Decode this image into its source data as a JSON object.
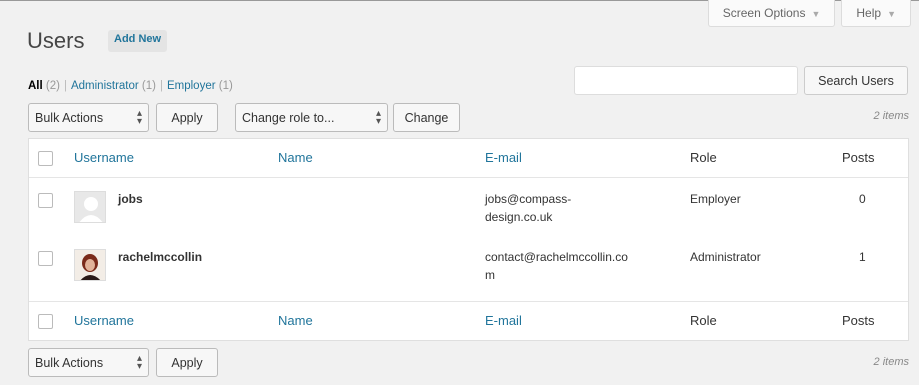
{
  "screen_options": {
    "screen_options_label": "Screen Options",
    "help_label": "Help"
  },
  "header": {
    "title": "Users",
    "add_new_label": "Add New"
  },
  "filters": [
    {
      "label": "All",
      "count": "(2)"
    },
    {
      "label": "Administrator",
      "count": "(1)"
    },
    {
      "label": "Employer",
      "count": "(1)"
    }
  ],
  "search": {
    "button_label": "Search Users"
  },
  "tablenav_top": {
    "bulk_actions_label": "Bulk Actions",
    "apply_label": "Apply",
    "change_role_label": "Change role to...",
    "change_label": "Change",
    "items_count": "2 items"
  },
  "table": {
    "columns": {
      "username": "Username",
      "name": "Name",
      "email": "E-mail",
      "role": "Role",
      "posts": "Posts"
    },
    "rows": [
      {
        "username": "jobs",
        "name": "",
        "email_line1": "jobs@compass-",
        "email_line2": "design.co.uk",
        "role": "Employer",
        "posts": "0"
      },
      {
        "username": "rachelmccollin",
        "name": "",
        "email_line1": "contact@rachelmccollin.co",
        "email_line2": "m",
        "role": "Administrator",
        "posts": "1"
      }
    ]
  },
  "tablenav_bottom": {
    "bulk_actions_label": "Bulk Actions",
    "apply_label": "Apply",
    "items_count": "2 items"
  }
}
